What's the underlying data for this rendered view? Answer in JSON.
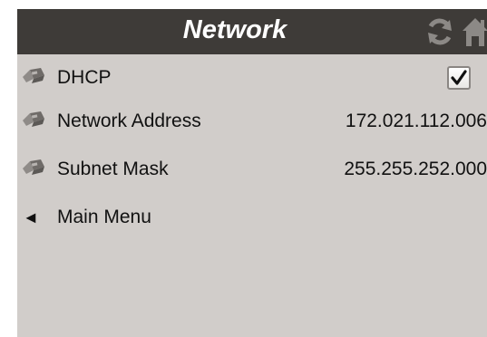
{
  "header": {
    "title": "Network",
    "icons": [
      "refresh-icon",
      "home-icon"
    ]
  },
  "rows": [
    {
      "label": "DHCP",
      "icon": "ethernet-plug-icon",
      "checked": true
    },
    {
      "label": "Network Address",
      "icon": "ethernet-plug-icon",
      "value": "172.021.112.006"
    },
    {
      "label": "Subnet Mask",
      "icon": "ethernet-plug-icon",
      "value": "255.255.252.000"
    }
  ],
  "back": {
    "label": "Main Menu",
    "glyph": "◄"
  },
  "colors": {
    "titlebar": "#3e3b38",
    "background": "#d1cdca",
    "title_text": "#ffffff",
    "icon": "#8c8986"
  }
}
